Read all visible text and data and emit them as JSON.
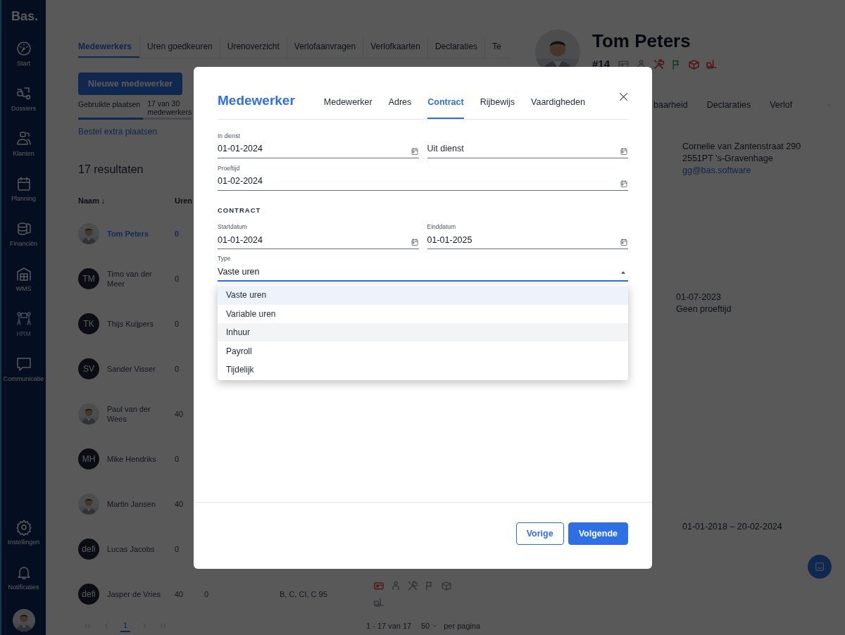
{
  "sidebar": {
    "logo": "Bas.",
    "items": [
      {
        "label": "Start",
        "selected": false
      },
      {
        "label": "Dossiers",
        "selected": false
      },
      {
        "label": "Klanten",
        "selected": false
      },
      {
        "label": "Planning",
        "selected": false
      },
      {
        "label": "Financiën",
        "selected": false
      },
      {
        "label": "WMS",
        "selected": false
      },
      {
        "label": "HRM",
        "selected": true
      },
      {
        "label": "Communicatie",
        "selected": false
      }
    ],
    "bottom_items": [
      {
        "label": "Instellingen"
      },
      {
        "label": "Notificaties"
      }
    ]
  },
  "tabs": [
    {
      "label": "Medewerkers",
      "selected": true
    },
    {
      "label": "Uren goedkeuren",
      "selected": false
    },
    {
      "label": "Urenoverzicht",
      "selected": false
    },
    {
      "label": "Verlofaanvragen",
      "selected": false
    },
    {
      "label": "Verlofkaarten",
      "selected": false
    },
    {
      "label": "Declaraties",
      "selected": false
    },
    {
      "label": "Te",
      "selected": false
    }
  ],
  "new_button": "Nieuwe medewerker",
  "seats": {
    "label": "Gebruikte plaatsen",
    "count": "17 van 30 medewerkers",
    "level": 0.57
  },
  "order_link": "Bestel extra plaatsen",
  "results": "17 resultaten",
  "table": {
    "columns": [
      "Naam ↓",
      "Uren"
    ],
    "rows": [
      {
        "name": "Tom Peters",
        "hours": "0",
        "selected": true
      },
      {
        "avatar": {
          "kind": "initials",
          "text": "TM"
        },
        "name": "Timo van der Meer",
        "hours": "0",
        "selected": false
      },
      {
        "avatar": {
          "kind": "initials",
          "text": "TK"
        },
        "name": "Thijs Kuijpers",
        "hours": "0",
        "selected": false
      },
      {
        "avatar": {
          "kind": "initials",
          "text": "SV"
        },
        "name": "Sander Visser",
        "hours": "0",
        "selected": false
      },
      {
        "name": "Paul van der Wees",
        "hours": "40",
        "selected": false
      },
      {
        "avatar": {
          "kind": "initials",
          "text": "MH"
        },
        "name": "Mike Hendriks",
        "hours": "0",
        "selected": false
      },
      {
        "name": "Martin Jansen",
        "hours": "40",
        "selected": false
      },
      {
        "avatar": {
          "kind": "initials",
          "text": "defi"
        },
        "name": "Lucas Jacobs",
        "hours": "0",
        "selected": false
      },
      {
        "avatar": {
          "kind": "initials",
          "text": "defi"
        },
        "name": "Jasper de Vries",
        "hours": "40",
        "selected": false,
        "column_3": "0",
        "column_4": "B, C, CI, C 95",
        "badges": [
          {
            "color": "#50191b"
          },
          {
            "color": "#37393d"
          },
          {
            "color": "#37393d"
          },
          {
            "color": "#37393d"
          },
          {
            "color": "#37393d"
          },
          {
            "color": "#37393d"
          }
        ]
      }
    ]
  },
  "pagination": {
    "page": "1",
    "range": "1 - 17 van 17",
    "per_page": "50",
    "per_page_label": "per pagina"
  },
  "profile": {
    "name": "Tom Peters",
    "number": "#14",
    "badges": [
      {
        "color": "#37393d"
      },
      {
        "color": "#37393d"
      },
      {
        "color": "#50191b"
      },
      {
        "color": "#153f28"
      },
      {
        "color": "#50191b"
      },
      {
        "color": "#50191b"
      }
    ],
    "tabs": [
      {
        "label": "baarheid",
        "selected": false
      },
      {
        "label": "Declaraties",
        "selected": false
      },
      {
        "label": "Verlof",
        "selected": false
      }
    ],
    "address": [
      "Cornelie van Zantenstraat 290",
      "2551PT 's-Gravenhage"
    ],
    "email": "gg@bas.software",
    "dates": [
      "01-07-2023",
      "Geen proeftijd"
    ],
    "period": "01-01-2018 – 20-02-2024"
  },
  "modal": {
    "title": "Medewerker",
    "tabs": [
      {
        "label": "Medewerker",
        "selected": false
      },
      {
        "label": "Adres",
        "selected": false
      },
      {
        "label": "Contract",
        "selected": true
      },
      {
        "label": "Rijbewijs",
        "selected": false
      },
      {
        "label": "Vaardigheden",
        "selected": false
      }
    ],
    "employment": [
      {
        "label": "In dienst",
        "value": "01-01-2024"
      },
      {
        "placeholder": "Uit dienst"
      }
    ],
    "probation": {
      "label": "Proeftijd",
      "value": "01-02-2024"
    },
    "contract_heading": "CONTRACT",
    "contract": [
      {
        "label": "Startdatum",
        "value": "01-01-2024"
      },
      {
        "label": "Einddatum",
        "value": "01-01-2025"
      }
    ],
    "type": {
      "label": "Type",
      "value": "Vaste uren",
      "expanded": true,
      "options": [
        {
          "label": "Vaste uren",
          "selected": true,
          "hovered": false
        },
        {
          "label": "Variable uren",
          "selected": false,
          "hovered": false
        },
        {
          "label": "Inhuur",
          "selected": false,
          "hovered": true
        },
        {
          "label": "Payroll",
          "selected": false,
          "hovered": false
        },
        {
          "label": "Tijdelijk",
          "selected": false,
          "hovered": false
        }
      ]
    },
    "buttons": [
      {
        "label": "Vorige",
        "kind": "secondary"
      },
      {
        "label": "Volgende",
        "kind": "primary"
      }
    ]
  }
}
